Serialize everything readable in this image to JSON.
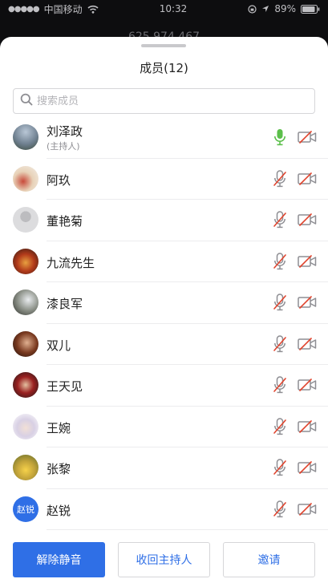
{
  "status_bar": {
    "carrier": "中国移动",
    "time": "10:32",
    "battery": "89%"
  },
  "meeting": {
    "id": "625 974 467"
  },
  "panel": {
    "title": "成员(12)",
    "search_placeholder": "搜索成员"
  },
  "members": [
    {
      "name": "刘泽政",
      "sub": "(主持人)",
      "mic": "on",
      "camera": "off"
    },
    {
      "name": "阿玖",
      "sub": "",
      "mic": "muted",
      "camera": "off"
    },
    {
      "name": "董艳菊",
      "sub": "",
      "mic": "muted",
      "camera": "off"
    },
    {
      "name": "九流先生",
      "sub": "",
      "mic": "muted",
      "camera": "off"
    },
    {
      "name": "漆良军",
      "sub": "",
      "mic": "muted",
      "camera": "off"
    },
    {
      "name": "双儿",
      "sub": "",
      "mic": "muted",
      "camera": "off"
    },
    {
      "name": "王天见",
      "sub": "",
      "mic": "muted",
      "camera": "off"
    },
    {
      "name": "王婉",
      "sub": "",
      "mic": "muted",
      "camera": "off"
    },
    {
      "name": "张黎",
      "sub": "",
      "mic": "muted",
      "camera": "off"
    },
    {
      "name": "赵锐",
      "sub": "",
      "mic": "muted",
      "camera": "off",
      "avatar_text": "赵锐"
    }
  ],
  "actions": {
    "unmute_all": "解除静音",
    "reclaim_host": "收回主持人",
    "invite": "邀请"
  },
  "colors": {
    "accent": "#2f6fe6",
    "mic_on": "#5bbf4a",
    "muted_slash": "#e0432d",
    "icon_gray": "#8e8e93"
  }
}
